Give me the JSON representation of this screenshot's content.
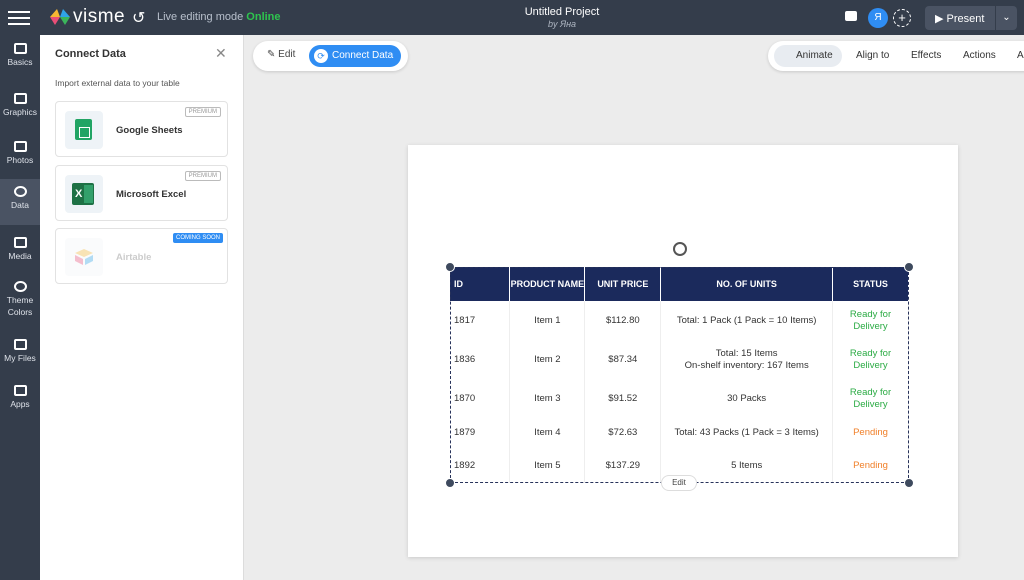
{
  "app": {
    "logo_text": "visme",
    "mode_label": "Live editing mode",
    "mode_status": "Online",
    "project_title": "Untitled Project",
    "project_author": "by Яна",
    "avatar_initial": "Я",
    "present_label": "Present"
  },
  "sidenav": {
    "items": [
      {
        "label": "Basics"
      },
      {
        "label": "Graphics"
      },
      {
        "label": "Photos"
      },
      {
        "label": "Data"
      },
      {
        "label": "Media"
      },
      {
        "label": "Theme Colors"
      },
      {
        "label": "My Files"
      },
      {
        "label": "Apps"
      }
    ]
  },
  "panel": {
    "title": "Connect Data",
    "subtitle": "Import external data to your table",
    "sources": [
      {
        "name": "Google Sheets",
        "badge": "PREMIUM"
      },
      {
        "name": "Microsoft Excel",
        "badge": "PREMIUM"
      },
      {
        "name": "Airtable",
        "badge": "COMING SOON"
      }
    ]
  },
  "toolbar": {
    "edit_label": "Edit",
    "connect_label": "Connect Data",
    "animate_label": "Animate",
    "align_label": "Align to",
    "effects_label": "Effects",
    "actions_label": "Actions",
    "more_label": "A"
  },
  "table": {
    "headers": [
      "ID",
      "PRODUCT NAME",
      "UNIT PRICE",
      "NO. OF UNITS",
      "STATUS"
    ],
    "rows": [
      {
        "id": "1817",
        "name": "Item 1",
        "price": "$112.80",
        "units": "Total: 1 Pack (1 Pack = 10 Items)",
        "units2": "",
        "status": "Ready for Delivery",
        "status_color": "#2bab44"
      },
      {
        "id": "1836",
        "name": "Item 2",
        "price": "$87.34",
        "units": "Total: 15 Items",
        "units2": "On-shelf inventory: 167 Items",
        "status": "Ready for Delivery",
        "status_color": "#2bab44"
      },
      {
        "id": "1870",
        "name": "Item 3",
        "price": "$91.52",
        "units": "30 Packs",
        "units2": "",
        "status": "Ready for Delivery",
        "status_color": "#2bab44"
      },
      {
        "id": "1879",
        "name": "Item 4",
        "price": "$72.63",
        "units": "Total: 43 Packs (1 Pack = 3 Items)",
        "units2": "",
        "status": "Pending",
        "status_color": "#f07f28"
      },
      {
        "id": "1892",
        "name": "Item 5",
        "price": "$137.29",
        "units": "5 Items",
        "units2": "",
        "status": "Pending",
        "status_color": "#f07f28"
      }
    ],
    "edit_label": "Edit"
  }
}
